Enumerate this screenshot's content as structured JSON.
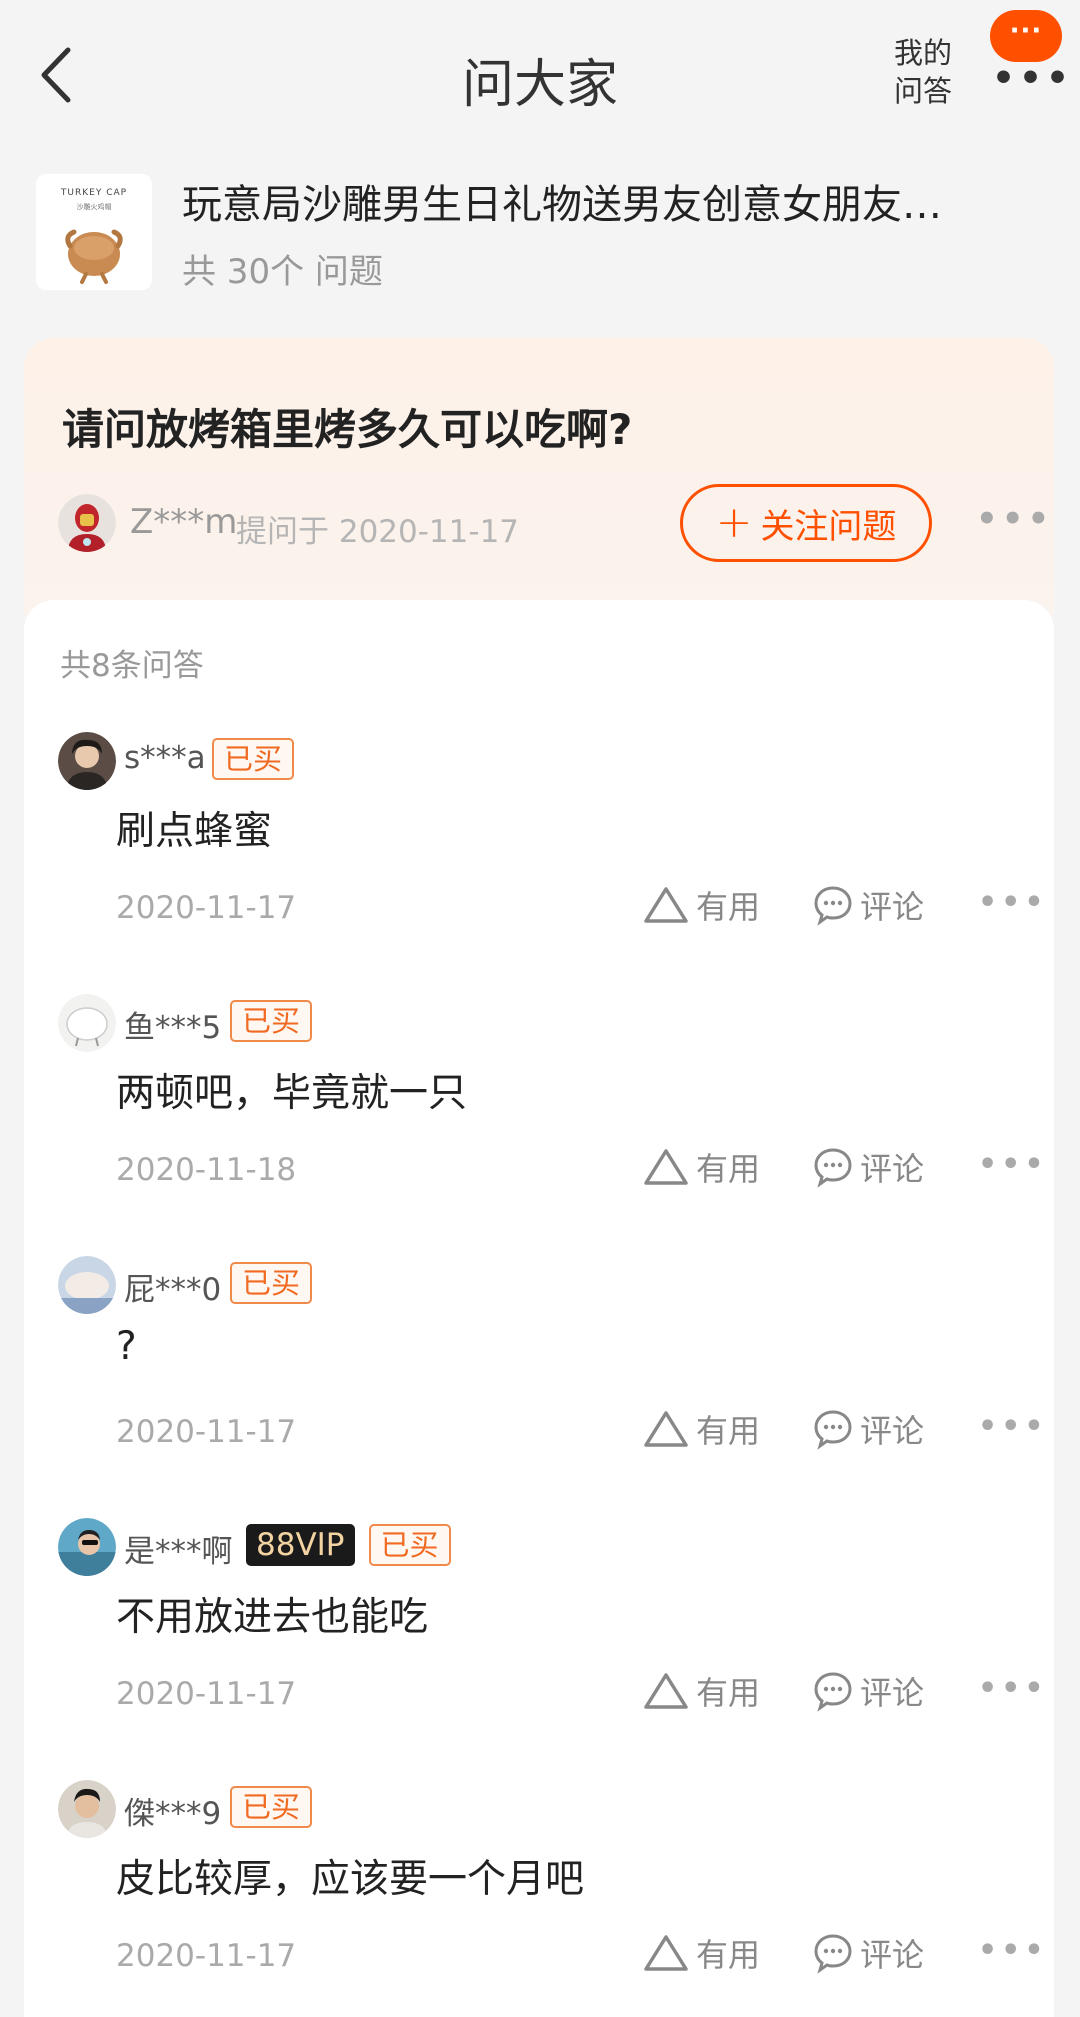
{
  "header": {
    "title": "问大家",
    "my_qa_line1": "我的",
    "my_qa_line2": "问答",
    "more_badge": "···",
    "more_dots": "•••"
  },
  "product": {
    "thumb_brand": "TURKEY CAP",
    "thumb_sub": "沙雕火鸡帽",
    "title": "玩意局沙雕男生日礼物送男友创意女朋友…",
    "question_count": "共 30个 问题"
  },
  "question": {
    "text": "请问放烤箱里烤多久可以吃啊?",
    "asker": "Z***m",
    "asked_at": "提问于 2020-11-17",
    "follow_plus": "+",
    "follow_label": "关注问题",
    "more": "•••"
  },
  "answers": {
    "count_label": "共8条问答",
    "useful_label": "有用",
    "comment_label": "评论",
    "more": "•••",
    "bought_label": "已买",
    "items": [
      {
        "user": "s***a",
        "vip": "",
        "text": "刷点蜂蜜",
        "date": "2020-11-17"
      },
      {
        "user": "鱼***5",
        "vip": "",
        "text": "两顿吧，毕竟就一只",
        "date": "2020-11-18"
      },
      {
        "user": "屁***0",
        "vip": "",
        "text": "?",
        "date": "2020-11-17"
      },
      {
        "user": "是***啊",
        "vip": "88VIP",
        "text": "不用放进去也能吃",
        "date": "2020-11-17"
      },
      {
        "user": "傑***9",
        "vip": "",
        "text": "皮比较厚，应该要一个月吧",
        "date": "2020-11-17"
      }
    ]
  },
  "colors": {
    "accent": "#ff5000",
    "badge_text": "#f06a22",
    "vip_bg": "#1a1a1a",
    "vip_text": "#f3d3a1"
  }
}
